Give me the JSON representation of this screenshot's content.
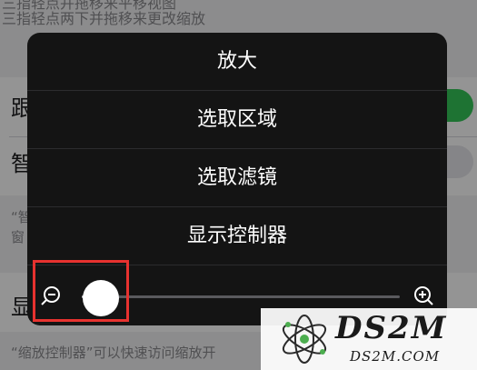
{
  "background": {
    "hint_lines": [
      "三指轻点并拖移来平移视图",
      "三指轻点两下并拖移来更改缩放"
    ],
    "rows": [
      {
        "label": "跟"
      },
      {
        "label": "智"
      },
      {
        "label": "显"
      }
    ],
    "footer_lines": [
      "“智",
      "窗",
      "“缩放控制器”可以快速访问缩放开"
    ]
  },
  "zoom_menu": {
    "items": [
      {
        "label": "放大"
      },
      {
        "label": "选取区域"
      },
      {
        "label": "选取滤镜"
      },
      {
        "label": "显示控制器"
      }
    ],
    "slider": {
      "value_fraction": 0.04,
      "min_icon": "zoom-out-icon",
      "max_icon": "zoom-in-icon"
    }
  },
  "colors": {
    "highlight": "#e8322f",
    "toggle_on": "#34c759",
    "panel": "#141414"
  },
  "watermark": {
    "title": "DS2M",
    "subtitle": "DS2M.COM"
  }
}
